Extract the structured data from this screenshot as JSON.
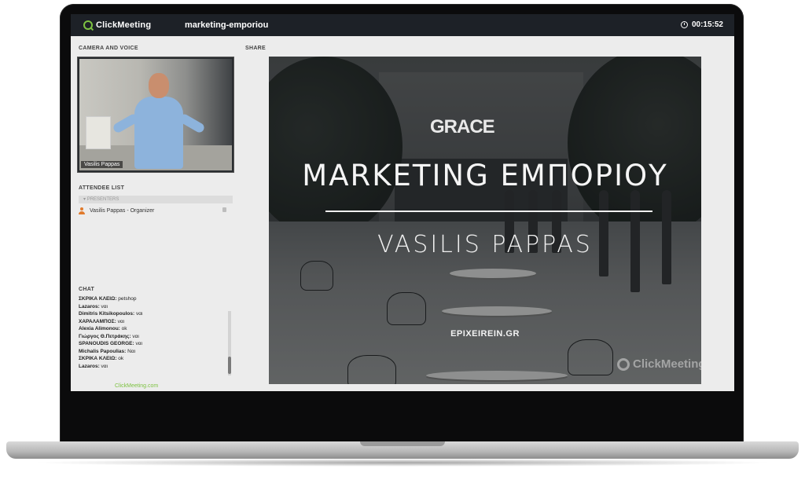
{
  "app": {
    "logo_text": "ClickMeeting",
    "event_title": "marketing-emporiou",
    "timer": "00:15:52"
  },
  "sections": {
    "camera_label": "CAMERA AND VOICE",
    "attendee_label": "ATTENDEE LIST",
    "chat_label": "CHAT",
    "share_label": "SHARE"
  },
  "camera": {
    "name_tag": "Vasilis Pappas"
  },
  "attendees": {
    "group_label": "PRESENTERS",
    "items": [
      {
        "name": "Vasilis Pappas - Organizer"
      }
    ]
  },
  "chat": {
    "messages": [
      {
        "user": "ΣΚΡΙΚΑ ΚΛΕΙΩ:",
        "text": "petshop"
      },
      {
        "user": "Lazaros:",
        "text": "ναι"
      },
      {
        "user": "Dimitris Kitsikopoulos:",
        "text": "ναι"
      },
      {
        "user": "ΧΑΡΑΛΑΜΠΟΣ:",
        "text": "ναι"
      },
      {
        "user": "Alexia Alimonou:",
        "text": "οk"
      },
      {
        "user": "Γιώργος Θ.Πετράκης:",
        "text": "ναι"
      },
      {
        "user": "SPANOUDIS GEORGE:",
        "text": "ναι"
      },
      {
        "user": "Michalis Papoulias:",
        "text": "Ναι"
      },
      {
        "user": "ΣΚΡΙΚΑ ΚΛΕΙΩ:",
        "text": "οk"
      },
      {
        "user": "Lazaros:",
        "text": "ναι"
      }
    ]
  },
  "footer": {
    "link": "ClickMeeting.com"
  },
  "slide": {
    "sign": "GRACE",
    "title": "MARKETING ΕΜΠΟΡΙΟΥ",
    "subtitle": "VASILIS PAPPAS",
    "site": "EPIXEIREIN.GR",
    "watermark": "ClickMeeting"
  },
  "colors": {
    "accent": "#7dc242",
    "topbar": "#1d2127",
    "organizer_icon": "#e07a2c"
  }
}
